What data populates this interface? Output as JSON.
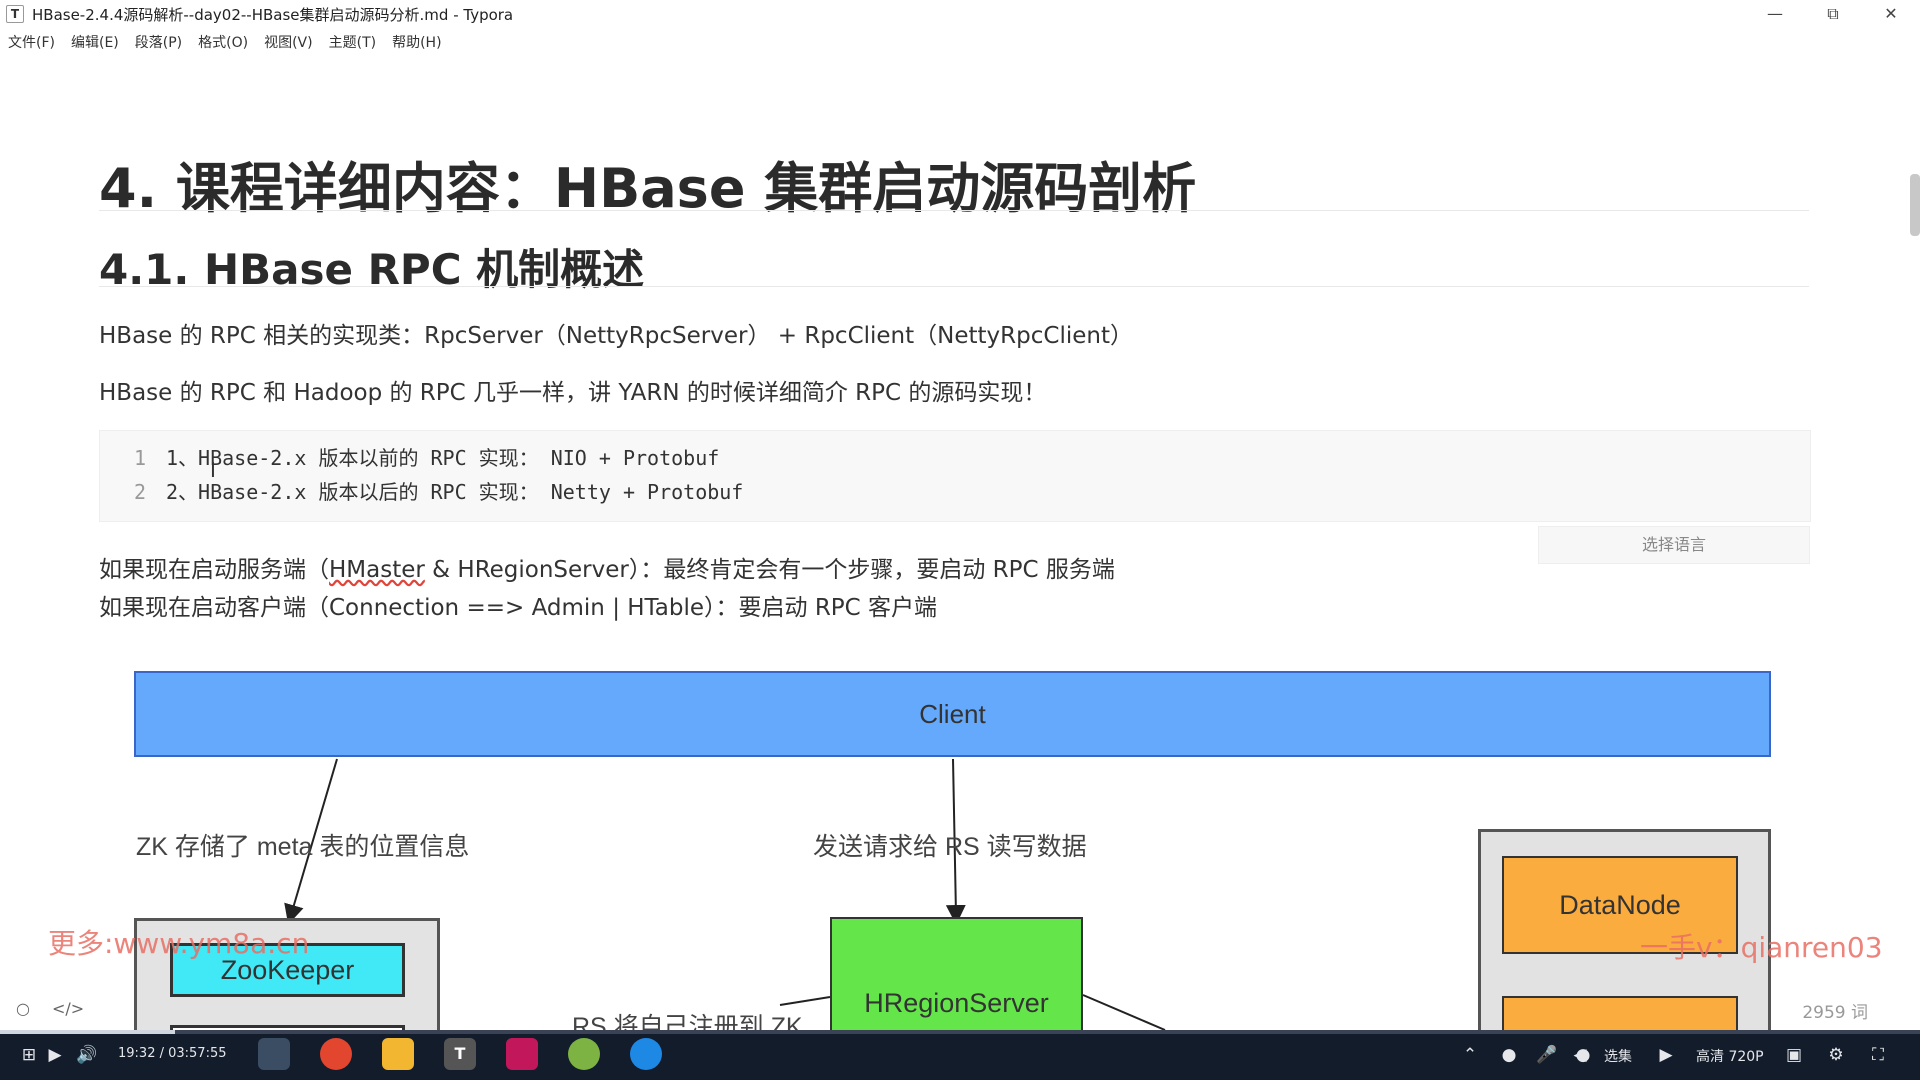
{
  "window": {
    "title": "HBase-2.4.4源码解析--day02--HBase集群启动源码分析.md - Typora",
    "app_icon": "T",
    "controls": [
      "minimize-icon",
      "restore-icon",
      "close-icon"
    ]
  },
  "menu": [
    "文件(F)",
    "编辑(E)",
    "段落(P)",
    "格式(O)",
    "视图(V)",
    "主题(T)",
    "帮助(H)"
  ],
  "doc": {
    "h1": "4. 课程详细内容：HBase 集群启动源码剖析",
    "h2": "4.1. HBase RPC 机制概述",
    "p1": "HBase 的 RPC 相关的实现类：RpcServer（NettyRpcServer） + RpcClient（NettyRpcClient）",
    "p2": "HBase 的 RPC 和 Hadoop 的 RPC 几乎一样，讲 YARN 的时候详细简介 RPC 的源码实现！",
    "code": [
      {
        "num": "1",
        "text": "1、HBase-2.x 版本以前的 RPC 实现： NIO + Protobuf"
      },
      {
        "num": "2",
        "text": "2、HBase-2.x 版本以后的 RPC 实现： Netty + Protobuf"
      }
    ],
    "lang_select": "选择语言",
    "p3_prefix": "如果现在启动服务端（",
    "p3_underlined": "HMaster",
    "p3_suffix": " & HRegionServer）：最终肯定会有一个步骤，要启动 RPC 服务端",
    "p4": "如果现在启动客户端（Connection ==> Admin | HTable）：要启动 RPC 客户端"
  },
  "diagram": {
    "client": "Client",
    "zookeeper": "ZooKeeper",
    "hregionserver": "HRegionServer",
    "datanode": "DataNode",
    "label_zk": "ZK 存储了 meta 表的位置信息",
    "label_rs": "发送请求给 RS 读写数据",
    "label_register": "RS 将自己注册到 ZK"
  },
  "watermarks": {
    "left": "更多:www.ym8a.cn",
    "right": "一手v：qianren03"
  },
  "status": {
    "word_count": "2959 词"
  },
  "player": {
    "time": "19:32 / 03:57:55",
    "episodes": "选集",
    "quality": "高清 720P"
  }
}
